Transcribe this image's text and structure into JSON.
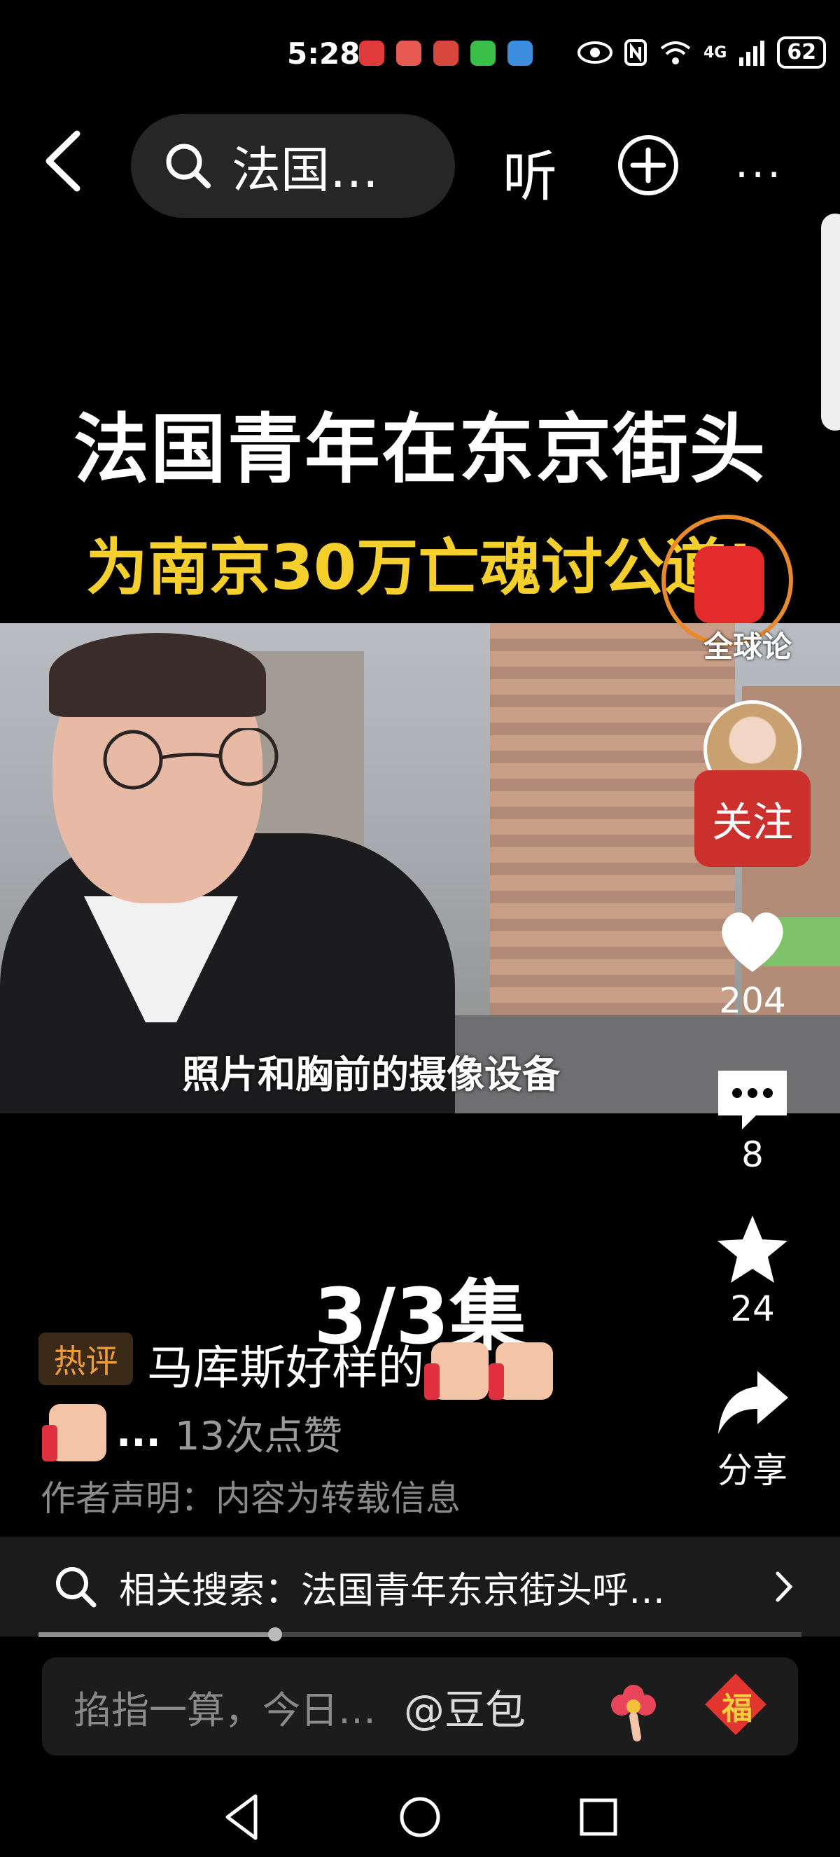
{
  "status_bar": {
    "time": "5:28",
    "network": "4G",
    "battery": "62",
    "app_icon_colors": [
      "#e03a3a",
      "#e65a52",
      "#d7473d",
      "#3cbf4a",
      "#3c8fde"
    ]
  },
  "top_nav": {
    "search_text": "法国…",
    "listen_label": "听",
    "more_label": "···"
  },
  "video": {
    "title_line1": "法国青年在东京街头",
    "title_line2": "为南京30万亡魂讨公道!",
    "subtitle": "照片和胸前的摄像设备"
  },
  "right_rail": {
    "account_label": "全球论",
    "follow_label": "关注",
    "like_count": "204",
    "comment_count": "8",
    "favorite_count": "24",
    "share_label": "分享"
  },
  "content": {
    "episode": "3/3集",
    "hot_badge": "热评",
    "comment_text": "马库斯好样的",
    "likes_dots": "...",
    "likes_text": "13次点赞",
    "notice": "作者声明：内容为转载信息"
  },
  "related": {
    "text": "相关搜索：法国青年东京街头呼…"
  },
  "progress": {
    "fraction": 0.31
  },
  "input_bar": {
    "placeholder": "掐指一算，今日…",
    "mention": "@豆包",
    "fu_char": "福"
  },
  "colors": {
    "background": "#000000",
    "accent_red": "#cc302d",
    "title_yellow": "#f5cf2c",
    "hot_orange": "#f09c38"
  },
  "icons": [
    "back-icon",
    "search-icon",
    "add-icon",
    "more-icon",
    "heart-icon",
    "comment-icon",
    "star-icon",
    "share-icon",
    "flower-icon",
    "fu-icon",
    "nav-back-icon",
    "nav-home-icon",
    "nav-recent-icon"
  ]
}
